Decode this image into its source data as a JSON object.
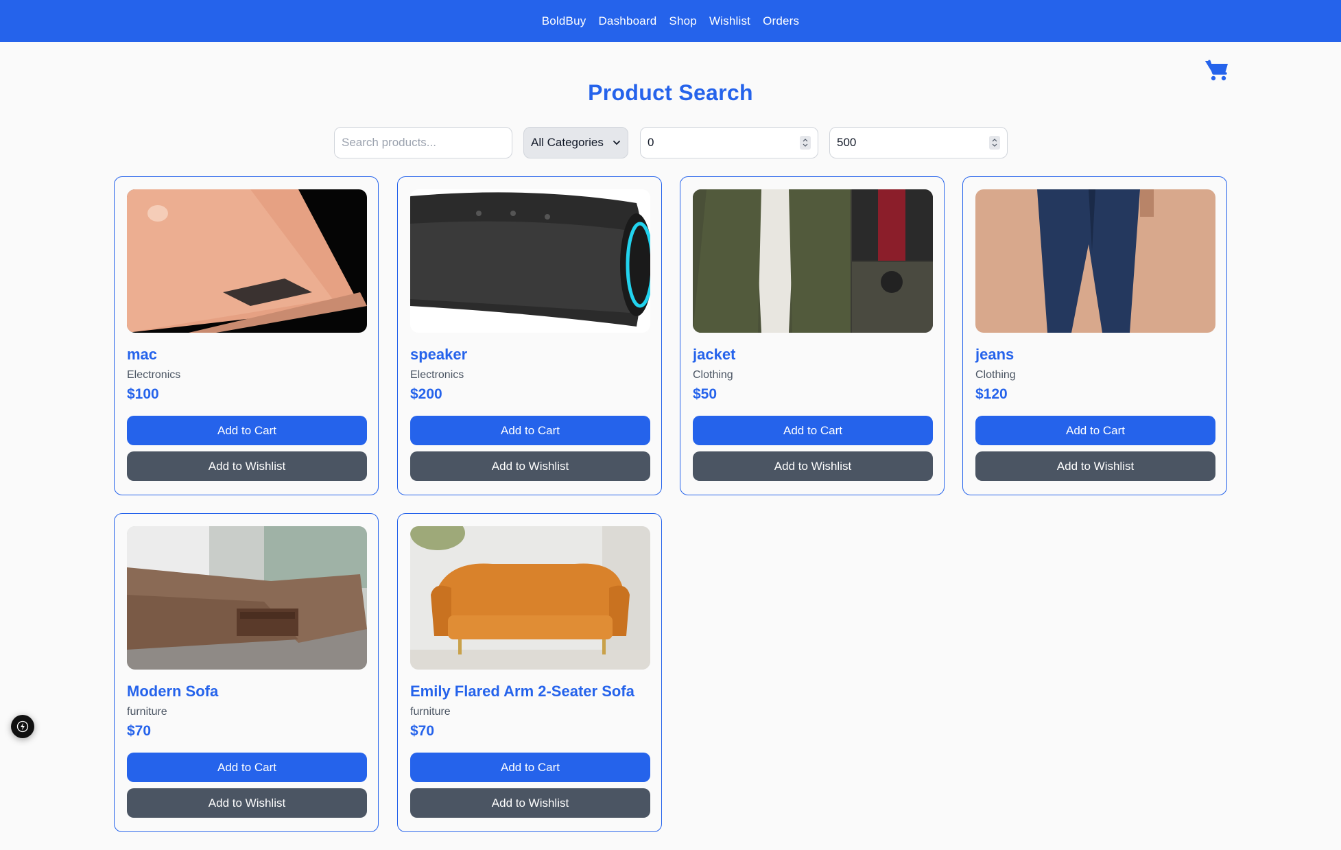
{
  "nav": {
    "brand": "BoldBuy",
    "links": [
      "Dashboard",
      "Shop",
      "Wishlist",
      "Orders"
    ]
  },
  "page": {
    "title": "Product Search"
  },
  "filters": {
    "search_placeholder": "Search products...",
    "search_value": "",
    "category_selected": "All Categories",
    "min_price": "0",
    "max_price": "500"
  },
  "products": [
    {
      "name": "mac",
      "category": "Electronics",
      "price": "$100",
      "add_to_cart": "Add to Cart",
      "add_to_wishlist": "Add to Wishlist"
    },
    {
      "name": "speaker",
      "category": "Electronics",
      "price": "$200",
      "add_to_cart": "Add to Cart",
      "add_to_wishlist": "Add to Wishlist"
    },
    {
      "name": "jacket",
      "category": "Clothing",
      "price": "$50",
      "add_to_cart": "Add to Cart",
      "add_to_wishlist": "Add to Wishlist"
    },
    {
      "name": "jeans",
      "category": "Clothing",
      "price": "$120",
      "add_to_cart": "Add to Cart",
      "add_to_wishlist": "Add to Wishlist"
    },
    {
      "name": "Modern Sofa",
      "category": "furniture",
      "price": "$70",
      "add_to_cart": "Add to Cart",
      "add_to_wishlist": "Add to Wishlist"
    },
    {
      "name": "Emily Flared Arm 2-Seater Sofa",
      "category": "furniture",
      "price": "$70",
      "add_to_cart": "Add to Cart",
      "add_to_wishlist": "Add to Wishlist"
    }
  ],
  "icons": {
    "cart": "shopping-cart-icon",
    "fab": "lightning-icon"
  },
  "colors": {
    "primary": "#2563eb",
    "secondary_button": "#4b5563",
    "background": "#fafafa"
  }
}
